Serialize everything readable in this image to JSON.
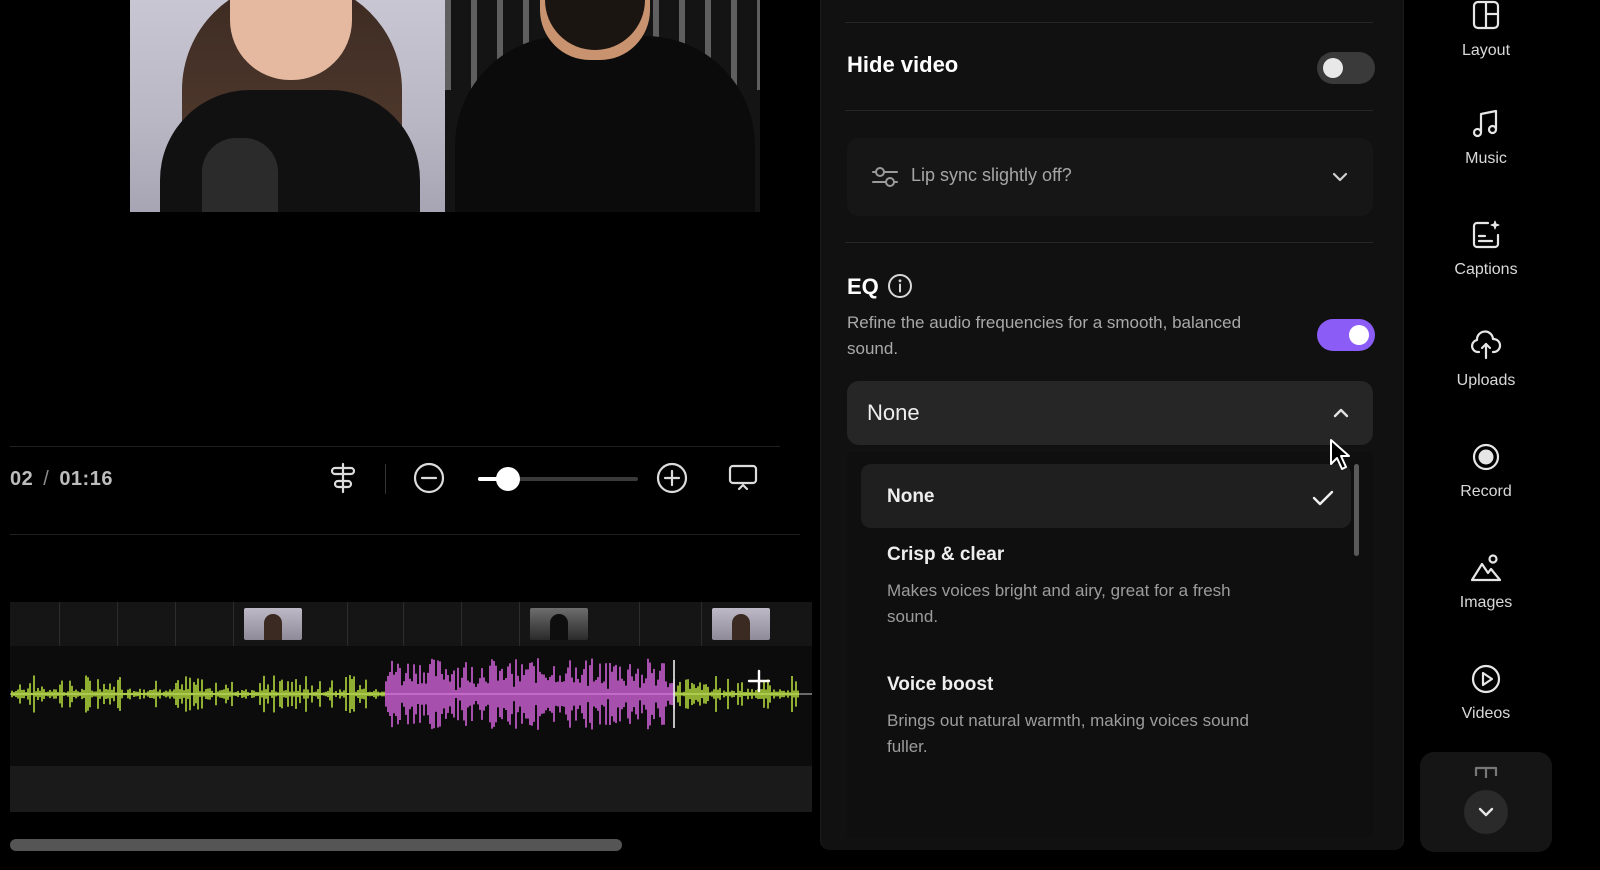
{
  "player": {
    "time_current": "02",
    "time_separator": "/",
    "time_total": "01:16",
    "zoom_percent": 19
  },
  "settings": {
    "hide_video": {
      "label": "Hide video",
      "enabled": false
    },
    "lip_sync": {
      "label": "Lip sync slightly off?"
    },
    "eq": {
      "title": "EQ",
      "description": "Refine the audio frequencies for a smooth, balanced sound.",
      "enabled": true,
      "selected_value": "None",
      "options": [
        {
          "title": "None",
          "description": "",
          "selected": true
        },
        {
          "title": "Crisp & clear",
          "description": "Makes voices bright and airy, great for a fresh sound.",
          "selected": false
        },
        {
          "title": "Voice boost",
          "description": "Brings out natural warmth, making voices sound fuller.",
          "selected": false
        }
      ]
    },
    "accent_color": "#8b5cf6"
  },
  "toolbar": {
    "items": [
      {
        "label": "Layout",
        "icon": "layout-icon"
      },
      {
        "label": "Music",
        "icon": "music-icon"
      },
      {
        "label": "Captions",
        "icon": "captions-icon"
      },
      {
        "label": "Uploads",
        "icon": "upload-icon"
      },
      {
        "label": "Record",
        "icon": "record-icon"
      },
      {
        "label": "Images",
        "icon": "images-icon"
      },
      {
        "label": "Videos",
        "icon": "videos-icon"
      }
    ],
    "more_icon": "chevron-down-icon"
  },
  "waveform": {
    "colors": {
      "speaker_a": "#c8f542",
      "speaker_b": "#e86cf0"
    }
  }
}
